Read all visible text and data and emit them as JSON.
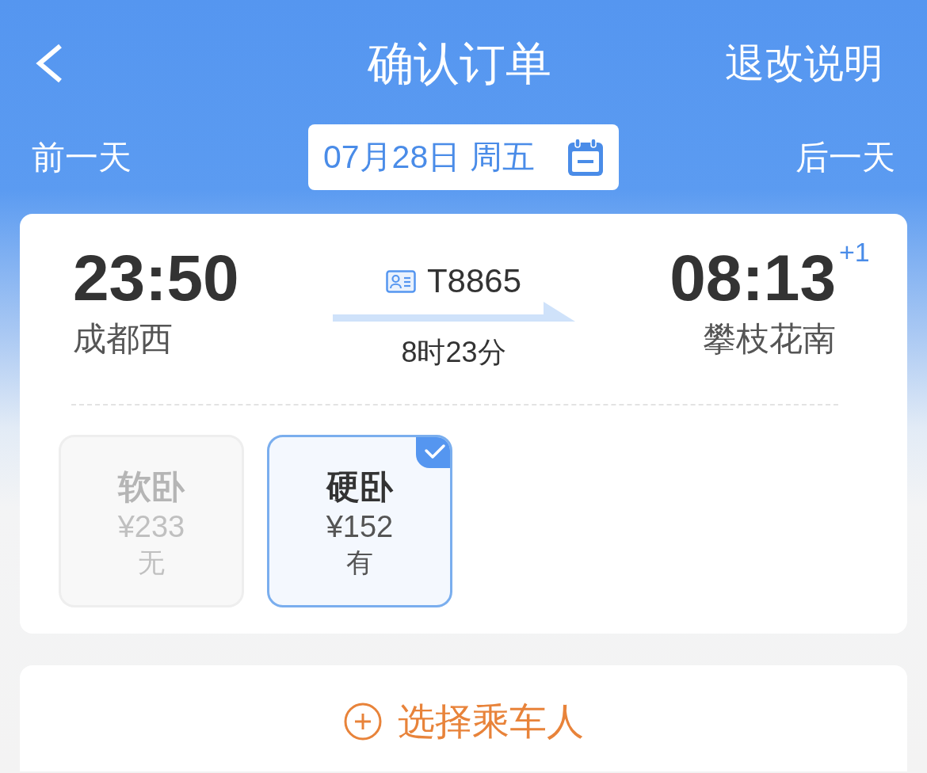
{
  "header": {
    "title": "确认订单",
    "action": "退改说明"
  },
  "date_bar": {
    "prev": "前一天",
    "date": "07月28日 周五",
    "next": "后一天"
  },
  "train": {
    "depart_time": "23:50",
    "depart_station": "成都西",
    "number": "T8865",
    "duration": "8时23分",
    "arrive_time": "08:13",
    "day_offset": "+1",
    "arrive_station": "攀枝花南"
  },
  "seats": [
    {
      "name": "软卧",
      "price": "¥233",
      "availability": "无",
      "available": false,
      "selected": false
    },
    {
      "name": "硬卧",
      "price": "¥152",
      "availability": "有",
      "available": true,
      "selected": true
    }
  ],
  "passenger_button": {
    "label": "选择乘车人"
  }
}
